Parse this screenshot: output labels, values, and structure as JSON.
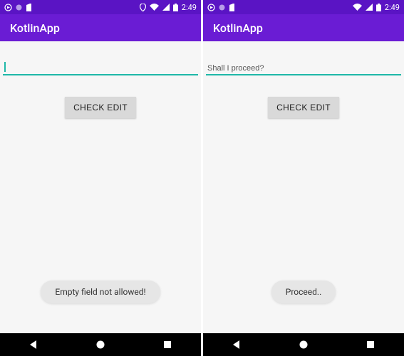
{
  "status": {
    "time": "2:49"
  },
  "appbar": {
    "title": "KotlinApp"
  },
  "screens": [
    {
      "input_value": "",
      "show_cursor": true,
      "toast": "Empty field not allowed!"
    },
    {
      "input_value": "Shall I proceed?",
      "show_cursor": false,
      "toast": "Proceed.."
    }
  ],
  "button": {
    "check_label": "CHECK EDIT"
  }
}
